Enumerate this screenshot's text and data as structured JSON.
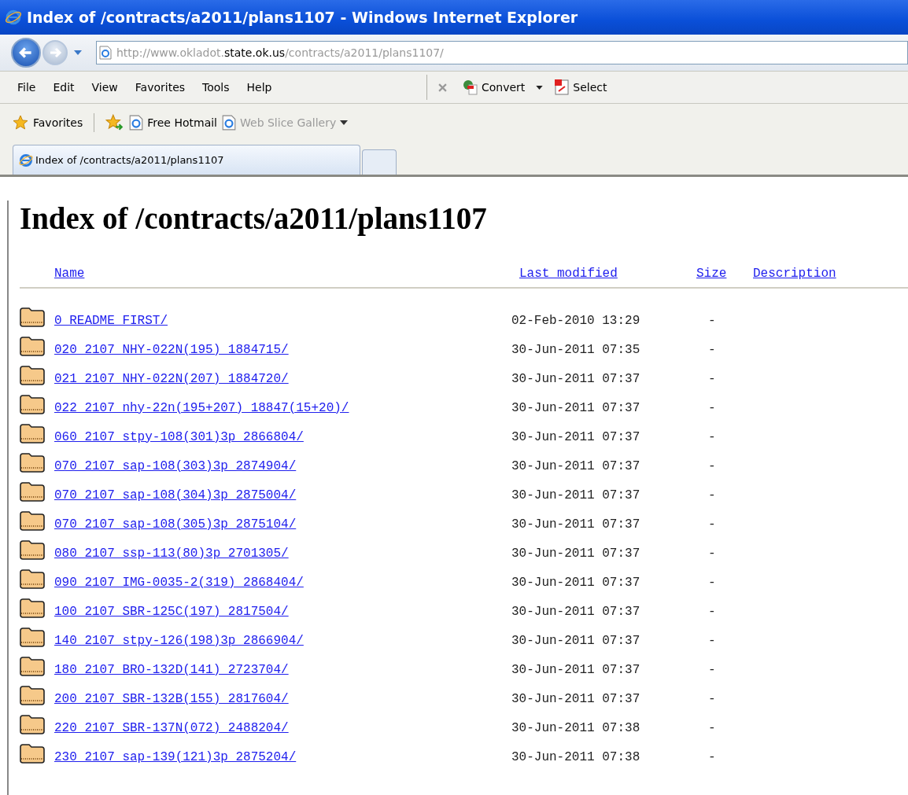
{
  "window": {
    "title": "Index of /contracts/a2011/plans1107 - Windows Internet Explorer"
  },
  "address": {
    "prefix": "http://www.okladot.",
    "host": "state.ok.us",
    "path": "/contracts/a2011/plans1107/"
  },
  "menu": [
    "File",
    "Edit",
    "View",
    "Favorites",
    "Tools",
    "Help"
  ],
  "toolbar": {
    "convert": "Convert",
    "select": "Select"
  },
  "favorites_bar": {
    "label": "Favorites",
    "links": [
      {
        "label": "Free Hotmail",
        "disabled": false
      },
      {
        "label": "Web Slice Gallery",
        "disabled": true
      }
    ]
  },
  "tabs": [
    {
      "label": "Index of /contracts/a2011/plans1107",
      "selected": true
    }
  ],
  "page": {
    "heading": "Index of /contracts/a2011/plans1107",
    "columns": [
      "Name",
      "Last modified",
      "Size",
      "Description"
    ],
    "rows": [
      {
        "name": "0_README_FIRST/",
        "modified": "02-Feb-2010 13:29",
        "size": "-"
      },
      {
        "name": "020_2107_NHY-022N(195)_1884715/",
        "modified": "30-Jun-2011 07:35",
        "size": "-"
      },
      {
        "name": "021_2107_NHY-022N(207)_1884720/",
        "modified": "30-Jun-2011 07:37",
        "size": "-"
      },
      {
        "name": "022_2107_nhy-22n(195+207)_18847(15+20)/",
        "modified": "30-Jun-2011 07:37",
        "size": "-"
      },
      {
        "name": "060_2107_stpy-108(301)3p_2866804/",
        "modified": "30-Jun-2011 07:37",
        "size": "-"
      },
      {
        "name": "070_2107_sap-108(303)3p_2874904/",
        "modified": "30-Jun-2011 07:37",
        "size": "-"
      },
      {
        "name": "070_2107_sap-108(304)3p_2875004/",
        "modified": "30-Jun-2011 07:37",
        "size": "-"
      },
      {
        "name": "070_2107_sap-108(305)3p_2875104/",
        "modified": "30-Jun-2011 07:37",
        "size": "-"
      },
      {
        "name": "080_2107_ssp-113(80)3p_2701305/",
        "modified": "30-Jun-2011 07:37",
        "size": "-"
      },
      {
        "name": "090_2107_IMG-0035-2(319)_2868404/",
        "modified": "30-Jun-2011 07:37",
        "size": "-"
      },
      {
        "name": "100_2107_SBR-125C(197)_2817504/",
        "modified": "30-Jun-2011 07:37",
        "size": "-"
      },
      {
        "name": "140_2107_stpy-126(198)3p_2866904/",
        "modified": "30-Jun-2011 07:37",
        "size": "-"
      },
      {
        "name": "180_2107_BRO-132D(141)_2723704/",
        "modified": "30-Jun-2011 07:37",
        "size": "-"
      },
      {
        "name": "200_2107_SBR-132B(155)_2817604/",
        "modified": "30-Jun-2011 07:37",
        "size": "-"
      },
      {
        "name": "220_2107_SBR-137N(072)_2488204/",
        "modified": "30-Jun-2011 07:38",
        "size": "-"
      },
      {
        "name": "230_2107_sap-139(121)3p_2875204/",
        "modified": "30-Jun-2011 07:38",
        "size": "-"
      }
    ]
  }
}
